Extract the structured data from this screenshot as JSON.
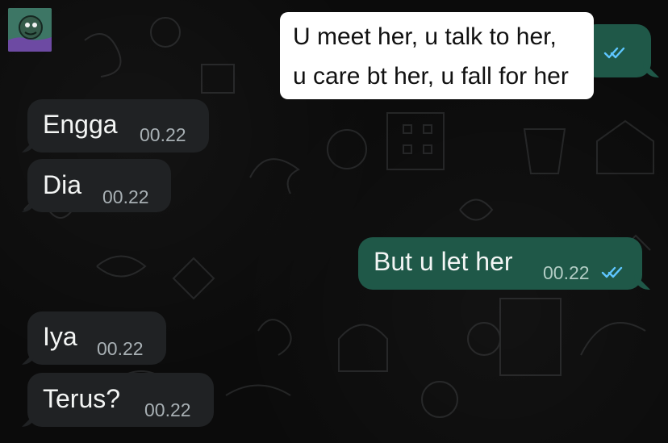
{
  "chat": {
    "avatar_icon": "sticker-avatar-icon",
    "colors": {
      "background": "#0b0b0b",
      "incoming_bubble": "#202224",
      "outgoing_bubble": "#1f5848",
      "read_ticks": "#5ec6ff"
    },
    "quoted_image": {
      "line1": "U meet her, u talk to her,",
      "line2": "u care bt her, u fall for her"
    },
    "messages": [
      {
        "side": "incoming",
        "text": "Engga",
        "time": "00.22"
      },
      {
        "side": "incoming",
        "text": "Dia",
        "time": "00.22"
      },
      {
        "side": "outgoing",
        "text": "But u let her",
        "time": "00.22",
        "status_icon": "double-check-read-icon"
      },
      {
        "side": "incoming",
        "text": "Iya",
        "time": "00.22"
      },
      {
        "side": "incoming",
        "text": "Terus?",
        "time": "00.22"
      }
    ]
  }
}
